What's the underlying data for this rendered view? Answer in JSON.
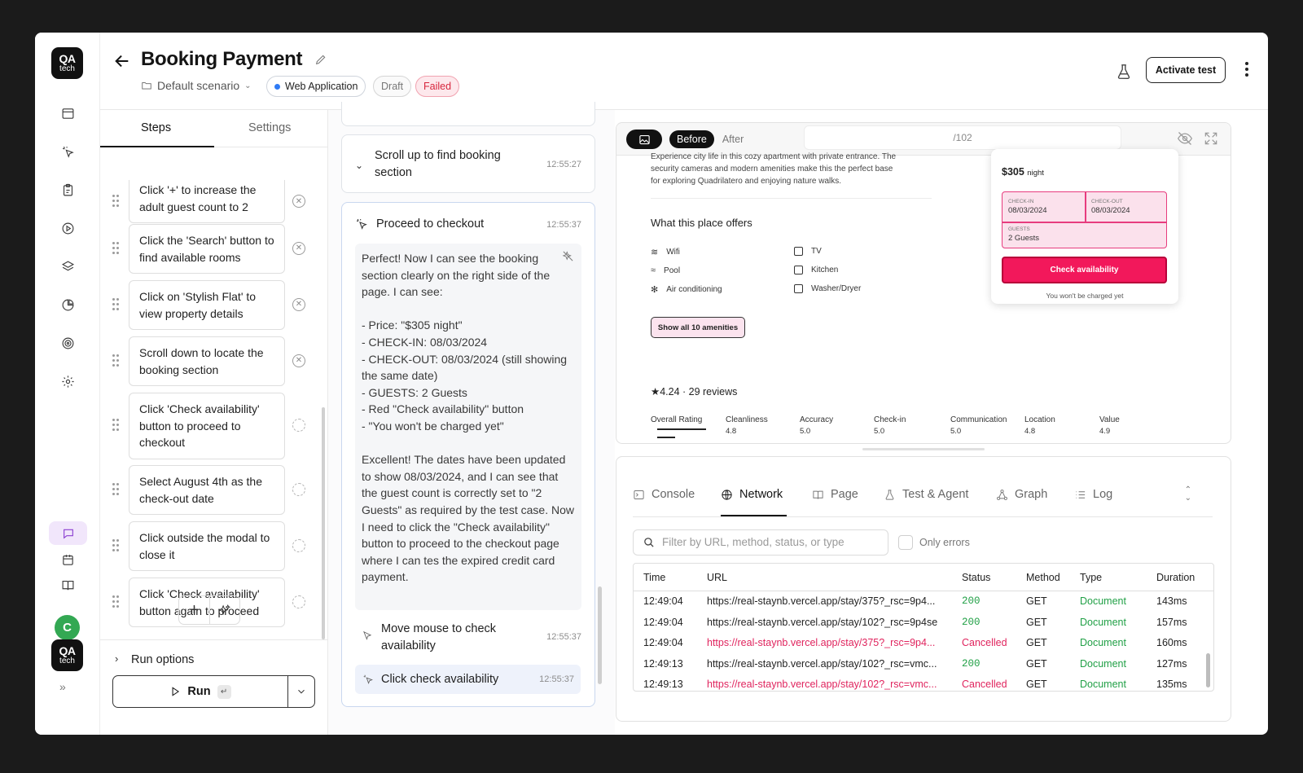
{
  "brand": {
    "logo_top": "QA",
    "logo_bottom": "tech"
  },
  "header": {
    "title": "Booking Payment",
    "scenario": "Default scenario",
    "badge_web": "Web Application",
    "badge_draft": "Draft",
    "badge_failed": "Failed",
    "activate_label": "Activate test"
  },
  "user": {
    "avatar_initial": "C"
  },
  "steps_panel": {
    "tabs": [
      "Steps",
      "Settings"
    ],
    "steps": [
      "Click '+' to increase the adult guest count to 2",
      "Click the 'Search' button to find available rooms",
      "Click on 'Stylish Flat' to view property details",
      "Scroll down to locate the booking section",
      "Click 'Check availability' button to proceed to checkout",
      "Select August 4th as the check-out date",
      "Click outside the modal to close it",
      "Click 'Check availability' button again to proceed"
    ],
    "run_options_label": "Run options",
    "run_label": "Run",
    "run_shortcut": "↵"
  },
  "agent_log": {
    "scroll_card": {
      "title": "Scroll up to find booking section",
      "time": "12:55:27"
    },
    "checkout_card": {
      "title": "Proceed to checkout",
      "time": "12:55:37",
      "reasoning": "Perfect! Now I can see the booking section clearly on the right side of the page. I can see:\n\n- Price: \"$305 night\"\n- CHECK-IN: 08/03/2024\n- CHECK-OUT: 08/03/2024 (still showing the same date)\n- GUESTS: 2 Guests\n- Red \"Check availability\" button\n- \"You won't be charged yet\"\n\nExcellent! The dates have been updated to show 08/03/2024, and I can see that the guest count is correctly set to \"2 Guests\" as required by the test case. Now I need to click the \"Check availability\" button to proceed to the checkout page where I can tes the expired credit card payment.",
      "substeps": [
        {
          "title": "Move mouse to check availability",
          "time": "12:55:37"
        },
        {
          "title": "Click check availability",
          "time": "12:55:37"
        }
      ]
    }
  },
  "preview": {
    "before_label": "Before",
    "after_label": "After",
    "url": "/102",
    "site": {
      "description": "Experience city life in this cozy apartment with private entrance. The security cameras and modern amenities make this the perfect base for exploring Quadrilatero and enjoying nature walks.",
      "offers_title": "What this place offers",
      "amenities": [
        "Wifi",
        "TV",
        "Pool",
        "Kitchen",
        "Air conditioning",
        "Washer/Dryer"
      ],
      "show_all_label": "Show all 10 amenities",
      "rating_summary": "★4.24 · 29 reviews",
      "rating_categories": [
        {
          "label": "Overall Rating",
          "value": ""
        },
        {
          "label": "Cleanliness",
          "value": "4.8"
        },
        {
          "label": "Accuracy",
          "value": "5.0"
        },
        {
          "label": "Check-in",
          "value": "5.0"
        },
        {
          "label": "Communication",
          "value": "5.0"
        },
        {
          "label": "Location",
          "value": "4.8"
        },
        {
          "label": "Value",
          "value": "4.9"
        }
      ],
      "booking": {
        "price": "$305",
        "price_unit": "night",
        "checkin_label": "CHECK-IN",
        "checkin_value": "08/03/2024",
        "checkout_label": "CHECK-OUT",
        "checkout_value": "08/03/2024",
        "guests_label": "GUESTS",
        "guests_value": "2 Guests",
        "button_label": "Check availability",
        "note": "You won't be charged yet"
      }
    }
  },
  "devtools": {
    "tabs": [
      "Console",
      "Network",
      "Page",
      "Test & Agent",
      "Graph",
      "Log"
    ],
    "active_tab": "Network",
    "filter_placeholder": "Filter by URL, method, status, or type",
    "only_errors_label": "Only errors",
    "columns": [
      "Time",
      "URL",
      "Status",
      "Method",
      "Type",
      "Duration"
    ],
    "rows": [
      {
        "time": "12:49:04",
        "url": "https://real-staynb.vercel.app/stay/375?_rsc=9p4...",
        "status": "200",
        "method": "GET",
        "type": "Document",
        "duration": "143ms"
      },
      {
        "time": "12:49:04",
        "url": "https://real-staynb.vercel.app/stay/102?_rsc=9p4se",
        "status": "200",
        "method": "GET",
        "type": "Document",
        "duration": "157ms"
      },
      {
        "time": "12:49:04",
        "url": "https://real-staynb.vercel.app/stay/375?_rsc=9p4...",
        "status": "Cancelled",
        "method": "GET",
        "type": "Document",
        "duration": "160ms"
      },
      {
        "time": "12:49:13",
        "url": "https://real-staynb.vercel.app/stay/102?_rsc=vmc...",
        "status": "200",
        "method": "GET",
        "type": "Document",
        "duration": "127ms"
      },
      {
        "time": "12:49:13",
        "url": "https://real-staynb.vercel.app/stay/102?_rsc=vmc...",
        "status": "Cancelled",
        "method": "GET",
        "type": "Document",
        "duration": "135ms"
      }
    ]
  },
  "colors": {
    "accent_purple": "#8b3fd1",
    "failed_red": "#d7263d",
    "status_ok": "#21a046",
    "status_cancelled": "#e0245e",
    "brand_pink": "#f2185b"
  }
}
